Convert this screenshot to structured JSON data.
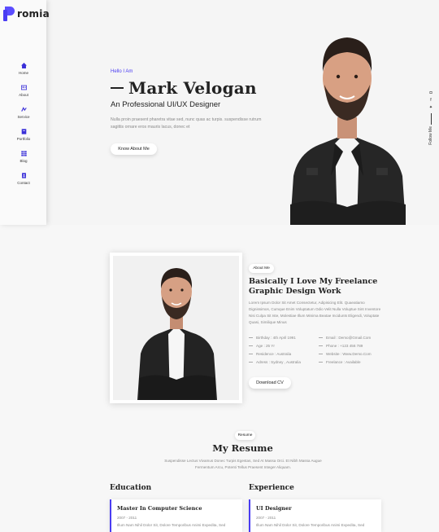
{
  "brand": {
    "logo_text": "romia"
  },
  "sidebar": {
    "items": [
      {
        "label": "Home",
        "icon": "home-icon"
      },
      {
        "label": "About",
        "icon": "user-card-icon"
      },
      {
        "label": "Service",
        "icon": "service-icon"
      },
      {
        "label": "Portfolio",
        "icon": "portfolio-icon"
      },
      {
        "label": "Blog",
        "icon": "blog-grid-icon"
      },
      {
        "label": "Contact",
        "icon": "contact-icon"
      }
    ]
  },
  "hero": {
    "greeting": "Hello I Am",
    "name": "Mark Velogan",
    "role": "An Professional UI/UX Designer",
    "description": "Nulla proin praesent pharetra vitae sed, nunc quas ac turpis. suspendisse rutrum sagittis ornare eros mauris lacus, donec et",
    "cta": "Know About Me",
    "follow_label": "Follow Me",
    "social": [
      "dribbble-icon",
      "facebook-icon",
      "twitter-icon"
    ]
  },
  "about": {
    "tag": "About Me",
    "title": "Basically I Love My Freelance Graphic Design Work",
    "text": "Lorem Ipsum Dolor Sit Amet Consectetur, Adipisicing Elit. Quaeatiamo Dignissimos, Cumque Enim Voluptatum Odio Velit Nulla Voluptue Sint Inventore Nisi Culpa Sit Iste, Molestiae Illum Minima Beatae Incidunts Eligendi, Voluptate Quasi, Similique Minus",
    "info": [
      "Birthday : 4th April 1991",
      "Email : Demo@Gmail.Com",
      "Age : 25 Yr",
      "Phone : +123 456 789",
      "Residence : Australia",
      "Website : Www.Demo.Com",
      "Adress : Sydney , Australia",
      "Freelance : Available"
    ],
    "cta": "Download CV"
  },
  "resume": {
    "tag": "Resume",
    "title": "My Resume",
    "text": "Suspendisse Lectus Vivamus Donec Turpis Egestas, Sed At Massa Orci. Et Nibh Massa Augue Fermentum Arcu, Potenti Tellus Praesent Integer Aliquam.",
    "education_title": "Education",
    "experience_title": "Experience",
    "education": {
      "title": "Master In Computer Science",
      "years": "2007 - 2011",
      "text": "Illum Nam Nihil Dolor Sit, Dolore Temporibus Animi Expedita, Sed"
    },
    "experience": {
      "title": "UI Designer",
      "years": "2007 - 2011",
      "text": "Illum Nam Nihil Dolor Sit, Dolore Temporibus Animi Expedita, Sed"
    }
  }
}
